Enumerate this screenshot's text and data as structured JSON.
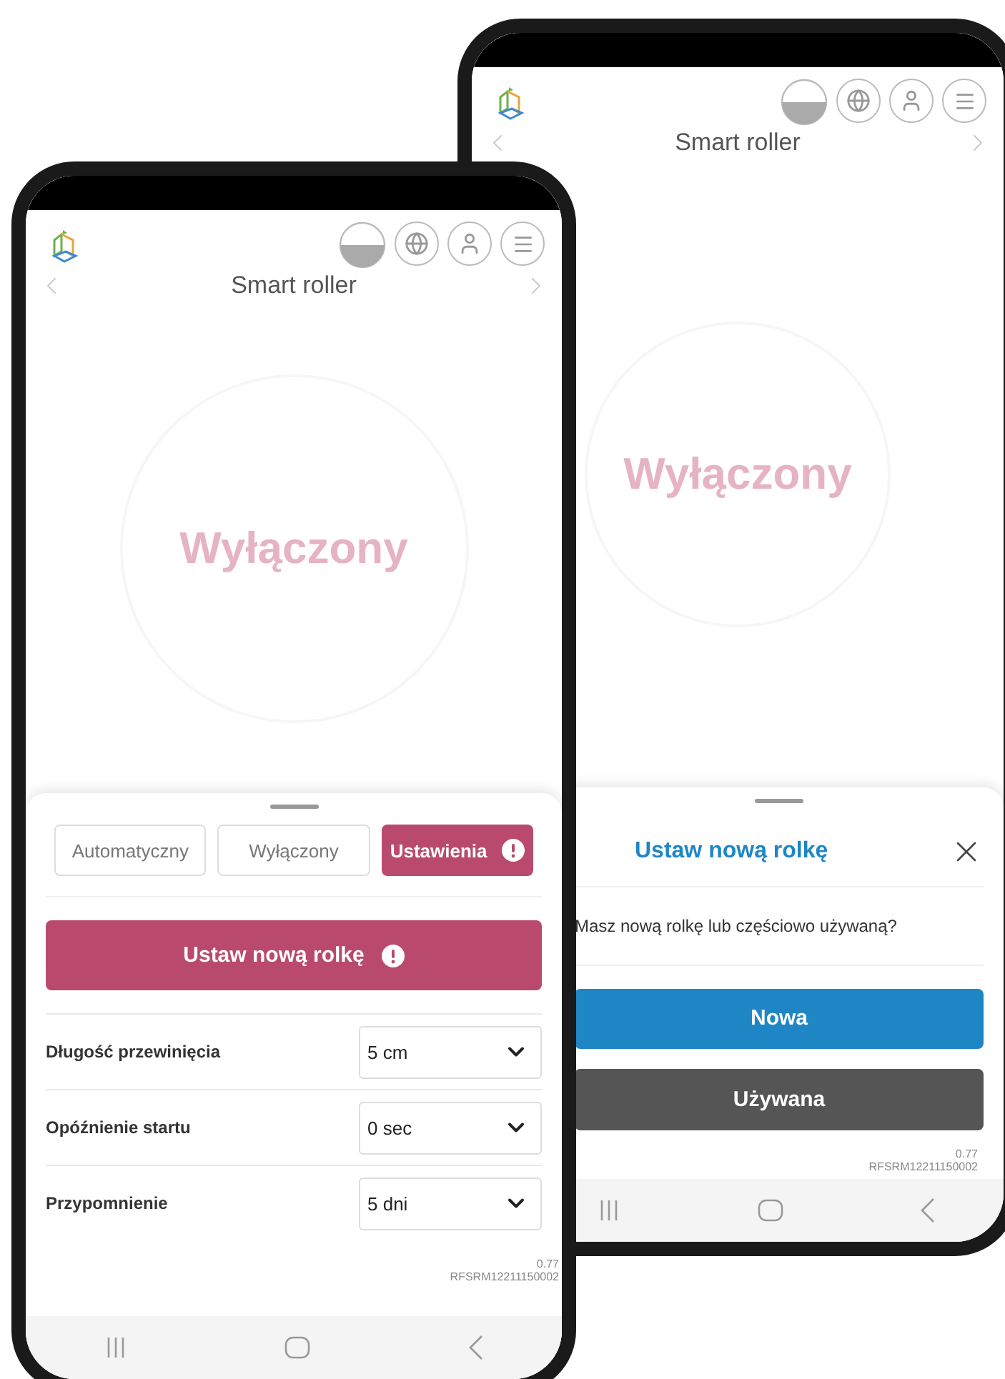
{
  "back_phone": {
    "header": {
      "title": "Smart roller"
    },
    "status": "Wyłączony",
    "dialog": {
      "title": "Ustaw nową rolkę",
      "message": "Masz nową rolkę lub częściowo używaną?",
      "buttons": [
        {
          "label": "Nowa",
          "kind": "primary"
        },
        {
          "label": "Używana",
          "kind": "secondary"
        }
      ]
    },
    "version": [
      "0.77",
      "RFSRM12211150002"
    ]
  },
  "front_phone": {
    "header": {
      "title": "Smart roller"
    },
    "status": "Wyłączony",
    "tabs": [
      {
        "label": "Automatyczny",
        "selected": false,
        "alert": false
      },
      {
        "label": "Wyłączony",
        "selected": false,
        "alert": false
      },
      {
        "label": "Ustawienia",
        "selected": true,
        "alert": true
      }
    ],
    "action_button": {
      "label": "Ustaw nową rolkę",
      "alert": true
    },
    "settings": [
      {
        "label": "Długość przewinięcia",
        "value": "5 cm"
      },
      {
        "label": "Opóźnienie startu",
        "value": "0 sec"
      },
      {
        "label": "Przypomnienie",
        "value": "5 dni"
      }
    ],
    "version": [
      "0.77",
      "RFSRM12211150002"
    ]
  }
}
